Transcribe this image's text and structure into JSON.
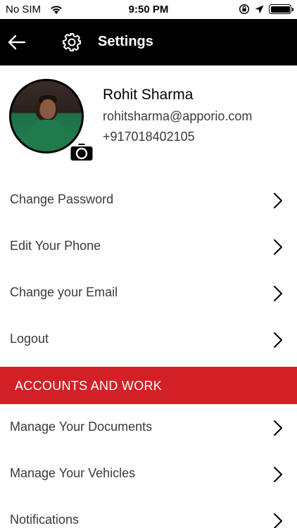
{
  "status_bar": {
    "carrier": "No SIM",
    "time": "9:50 PM"
  },
  "header": {
    "title": "Settings"
  },
  "profile": {
    "name": "Rohit Sharma",
    "email": "rohitsharma@apporio.com",
    "phone": "+917018402105"
  },
  "account_items": [
    {
      "label": "Change Password"
    },
    {
      "label": "Edit Your Phone"
    },
    {
      "label": "Change your Email"
    },
    {
      "label": "Logout"
    }
  ],
  "section": {
    "title": "ACCOUNTS AND WORK"
  },
  "work_items": [
    {
      "label": "Manage Your Documents"
    },
    {
      "label": "Manage Your Vehicles"
    },
    {
      "label": "Notifications"
    }
  ],
  "colors": {
    "header_bg": "#000000",
    "section_bg": "#d32027",
    "text": "#3a3a3a"
  },
  "icons": [
    "wifi-icon",
    "rotation-lock-icon",
    "location-arrow-icon",
    "battery-icon",
    "back-arrow-icon",
    "gear-icon",
    "camera-icon",
    "chevron-right-icon"
  ]
}
